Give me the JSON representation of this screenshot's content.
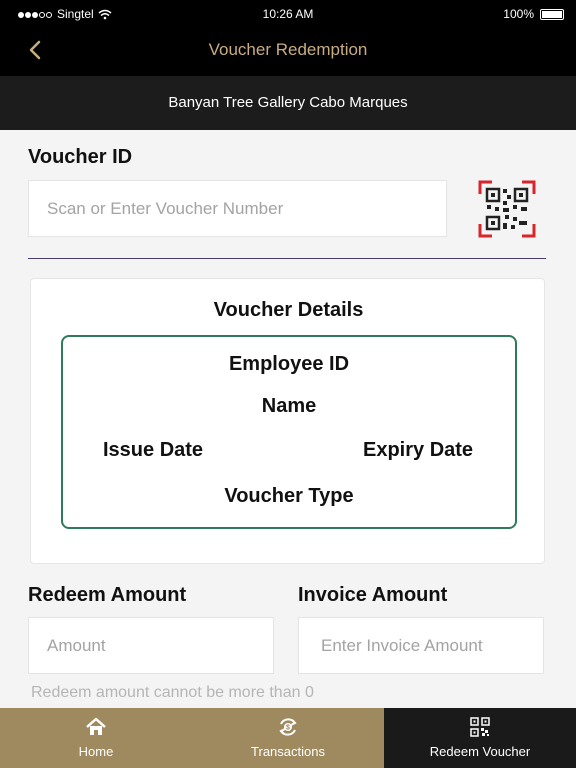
{
  "status_bar": {
    "carrier": "Singtel",
    "time": "10:26 AM",
    "battery": "100%"
  },
  "nav": {
    "title": "Voucher Redemption"
  },
  "location": {
    "name": "Banyan Tree Gallery Cabo Marques"
  },
  "voucher": {
    "label": "Voucher ID",
    "placeholder": "Scan or Enter Voucher Number"
  },
  "details": {
    "title": "Voucher Details",
    "employee_id": "Employee ID",
    "name": "Name",
    "issue_date": "Issue Date",
    "expiry_date": "Expiry Date",
    "voucher_type": "Voucher Type"
  },
  "redeem": {
    "label": "Redeem Amount",
    "placeholder": "Amount",
    "hint": "Redeem amount cannot be more than 0"
  },
  "invoice": {
    "label": "Invoice Amount",
    "placeholder": "Enter Invoice Amount"
  },
  "tabs": [
    {
      "label": "Home",
      "icon": "home-icon"
    },
    {
      "label": "Transactions",
      "icon": "transactions-icon"
    },
    {
      "label": "Redeem Voucher",
      "icon": "qr-code-icon"
    }
  ],
  "colors": {
    "nav_title": "#c8ad82",
    "tab_inactive_bg": "#9e8a5e",
    "tab_active_bg": "#1a1a1a",
    "details_border": "#2f7a5a",
    "divider": "#4a3d6d"
  }
}
